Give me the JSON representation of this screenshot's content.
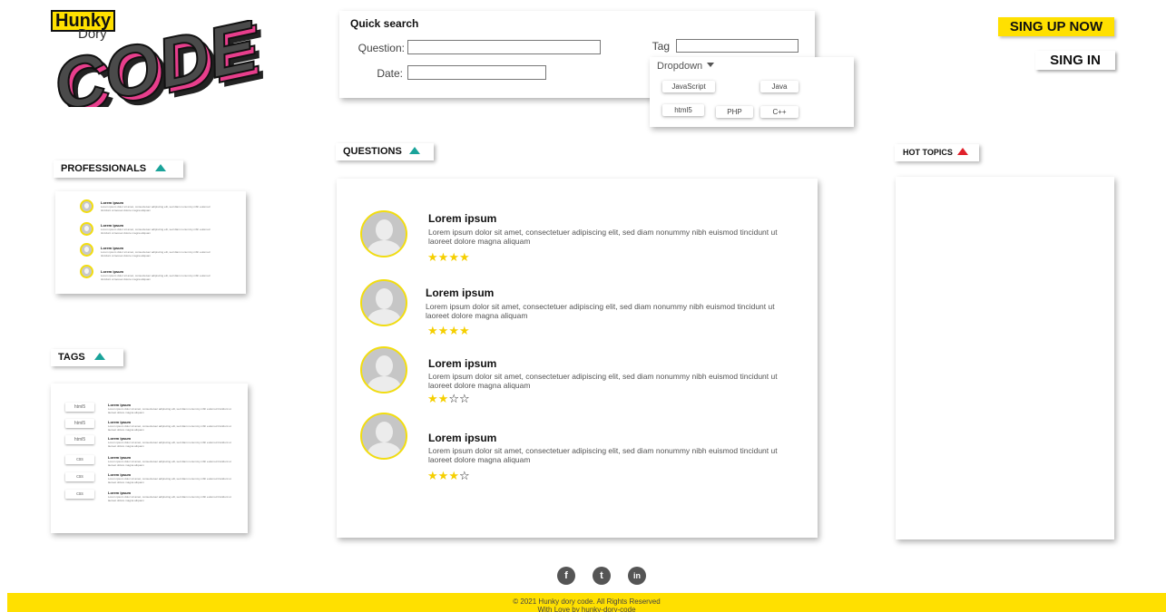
{
  "logo": {
    "hunky": "Hunky",
    "dory": "Dory",
    "code": "CODE"
  },
  "quick_search": {
    "title": "Quick search",
    "question_label": "Question:",
    "date_label": "Date:",
    "tag_label": "Tag",
    "question_value": "",
    "date_value": "",
    "tag_value": ""
  },
  "dropdown": {
    "label": "Dropdown",
    "options": [
      "JavaScript",
      "Java",
      "html5",
      "PHP",
      "C++"
    ]
  },
  "auth": {
    "signup": "SING UP NOW",
    "signin": "SING IN"
  },
  "sections": {
    "professionals": "PROFESSIONALS",
    "questions": "QUESTIONS",
    "hot_topics": "HOT TOPICS",
    "tags": "TAGS"
  },
  "professionals": [
    {
      "name": "Lorem ipsum",
      "text": "Lorem ipsum dolor sit amet, consectetuer adipiscing elit, sed diam nonummy nibh euismod tincidunt ut laoreet dolore magna aliquam"
    },
    {
      "name": "Lorem ipsum",
      "text": "Lorem ipsum dolor sit amet, consectetuer adipiscing elit, sed diam nonummy nibh euismod tincidunt ut laoreet dolore magna aliquam"
    },
    {
      "name": "Lorem ipsum",
      "text": "Lorem ipsum dolor sit amet, consectetuer adipiscing elit, sed diam nonummy nibh euismod tincidunt ut laoreet dolore magna aliquam"
    },
    {
      "name": "Lorem ipsum",
      "text": "Lorem ipsum dolor sit amet, consectetuer adipiscing elit, sed diam nonummy nibh euismod tincidunt ut laoreet dolore magna aliquam"
    }
  ],
  "tags": [
    {
      "tag": "html5",
      "title": "Lorem ipsum",
      "text": "Lorem ipsum dolor sit amet, consectetuer adipiscing elit, sed diam nonummy nibh euismod tincidunt ut laoreet dolore magna aliquam"
    },
    {
      "tag": "html5",
      "title": "Lorem ipsum",
      "text": "Lorem ipsum dolor sit amet, consectetuer adipiscing elit, sed diam nonummy nibh euismod tincidunt ut laoreet dolore magna aliquam"
    },
    {
      "tag": "html5",
      "title": "Lorem ipsum",
      "text": "Lorem ipsum dolor sit amet, consectetuer adipiscing elit, sed diam nonummy nibh euismod tincidunt ut laoreet dolore magna aliquam"
    },
    {
      "tag": "css",
      "title": "Lorem ipsum",
      "text": "Lorem ipsum dolor sit amet, consectetuer adipiscing elit, sed diam nonummy nibh euismod tincidunt ut laoreet dolore magna aliquam"
    },
    {
      "tag": "css",
      "title": "Lorem ipsum",
      "text": "Lorem ipsum dolor sit amet, consectetuer adipiscing elit, sed diam nonummy nibh euismod tincidunt ut laoreet dolore magna aliquam"
    },
    {
      "tag": "css",
      "title": "Lorem ipsum",
      "text": "Lorem ipsum dolor sit amet, consectetuer adipiscing elit, sed diam nonummy nibh euismod tincidunt ut laoreet dolore magna aliquam"
    }
  ],
  "questions": [
    {
      "title": "Lorem ipsum",
      "text": "Lorem ipsum dolor sit amet, consectetuer adipiscing elit, sed diam nonummy nibh euismod tincidunt ut laoreet dolore magna aliquam",
      "rating": 4
    },
    {
      "title": "Lorem ipsum",
      "text": "Lorem ipsum dolor sit amet, consectetuer adipiscing elit, sed diam nonummy nibh euismod tincidunt ut laoreet dolore magna aliquam",
      "rating": 4
    },
    {
      "title": "Lorem ipsum",
      "text": "Lorem ipsum dolor sit amet, consectetuer adipiscing elit, sed diam nonummy nibh euismod tincidunt ut laoreet dolore magna aliquam",
      "rating": 2,
      "rating_max": 4
    },
    {
      "title": "Lorem ipsum",
      "text": "Lorem ipsum dolor sit amet, consectetuer adipiscing elit, sed diam nonummy nibh euismod tincidunt ut laoreet dolore magna aliquam",
      "rating": 3,
      "rating_max": 4
    }
  ],
  "social": {
    "facebook": "f",
    "twitter": "t",
    "linkedin": "in"
  },
  "footer": {
    "copyright": "© 2021 Hunky dory code. All Rights Reserved",
    "love": "With Love by hunky-dory-code"
  },
  "colors": {
    "accent": "#ffe000",
    "avatar_ring": "#f2dd10",
    "teal": "#1aa39a",
    "red": "#e0202a"
  }
}
